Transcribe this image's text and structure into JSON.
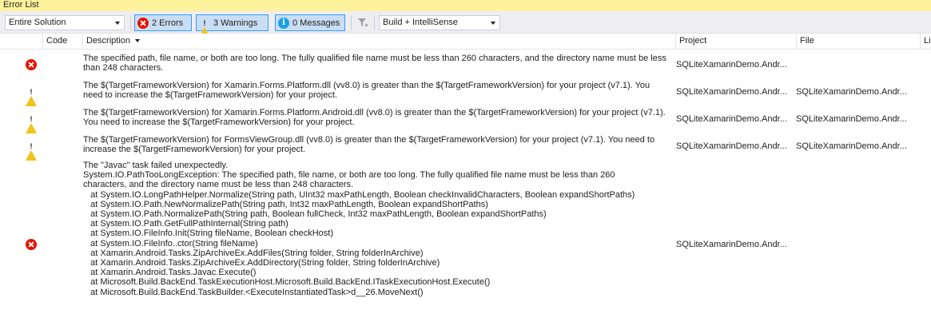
{
  "window": {
    "title": "Error List"
  },
  "toolbar": {
    "scope_value": "Entire Solution",
    "errors_label": "2 Errors",
    "warnings_label": "3 Warnings",
    "messages_label": "0 Messages",
    "source_value": "Build + IntelliSense"
  },
  "columns": {
    "code": "Code",
    "description": "Description",
    "project": "Project",
    "file": "File",
    "line": "Lin"
  },
  "rows": [
    {
      "severity": "error",
      "description": "The specified path, file name, or both are too long. The fully qualified file name must be less than 260 characters, and the directory name must be less than 248 characters.",
      "project": "SQLiteXamarinDemo.Andr...",
      "file": ""
    },
    {
      "severity": "warning",
      "description": "The $(TargetFrameworkVersion) for Xamarin.Forms.Platform.dll (vv8.0) is greater than the $(TargetFrameworkVersion) for your project (v7.1). You need to increase the $(TargetFrameworkVersion) for your project.",
      "project": "SQLiteXamarinDemo.Andr...",
      "file": "SQLiteXamarinDemo.Andr..."
    },
    {
      "severity": "warning",
      "description": "The $(TargetFrameworkVersion) for Xamarin.Forms.Platform.Android.dll (vv8.0) is greater than the $(TargetFrameworkVersion) for your project (v7.1). You need to increase the $(TargetFrameworkVersion) for your project.",
      "project": "SQLiteXamarinDemo.Andr...",
      "file": "SQLiteXamarinDemo.Andr..."
    },
    {
      "severity": "warning",
      "description": "The $(TargetFrameworkVersion) for FormsViewGroup.dll (vv8.0) is greater than the $(TargetFrameworkVersion) for your project (v7.1). You need to increase the $(TargetFrameworkVersion) for your project.",
      "project": "SQLiteXamarinDemo.Andr...",
      "file": "SQLiteXamarinDemo.Andr..."
    },
    {
      "severity": "error",
      "description_lines": [
        "The \"Javac\" task failed unexpectedly.",
        "System.IO.PathTooLongException: The specified path, file name, or both are too long. The fully qualified file name must be less than 260",
        "characters, and the directory name must be less than 248 characters.",
        "   at System.IO.LongPathHelper.Normalize(String path, UInt32 maxPathLength, Boolean checkInvalidCharacters, Boolean expandShortPaths)",
        "   at System.IO.Path.NewNormalizePath(String path, Int32 maxPathLength, Boolean expandShortPaths)",
        "   at System.IO.Path.NormalizePath(String path, Boolean fullCheck, Int32 maxPathLength, Boolean expandShortPaths)",
        "   at System.IO.Path.GetFullPathInternal(String path)",
        "   at System.IO.FileInfo.Init(String fileName, Boolean checkHost)",
        "   at System.IO.FileInfo..ctor(String fileName)",
        "   at Xamarin.Android.Tasks.ZipArchiveEx.AddFiles(String folder, String folderInArchive)",
        "   at Xamarin.Android.Tasks.ZipArchiveEx.AddDirectory(String folder, String folderInArchive)",
        "   at Xamarin.Android.Tasks.Javac.Execute()",
        "   at Microsoft.Build.BackEnd.TaskExecutionHost.Microsoft.Build.BackEnd.ITaskExecutionHost.Execute()",
        "   at Microsoft.Build.BackEnd.TaskBuilder.<ExecuteInstantiatedTask>d__26.MoveNext()"
      ],
      "project": "SQLiteXamarinDemo.Andr...",
      "file": ""
    }
  ],
  "colors": {
    "title_bar": "#fff29d",
    "toolbar_bg": "#eeeef2",
    "toggle_active_bg": "#c9def5",
    "toggle_active_border": "#3399ff",
    "error_icon": "#e51400",
    "warning_icon": "#f0c419",
    "info_icon": "#1ba1e2"
  },
  "icons": {
    "error": "error-icon",
    "warning": "warning-icon",
    "info": "info-icon",
    "filter": "filter-icon"
  }
}
